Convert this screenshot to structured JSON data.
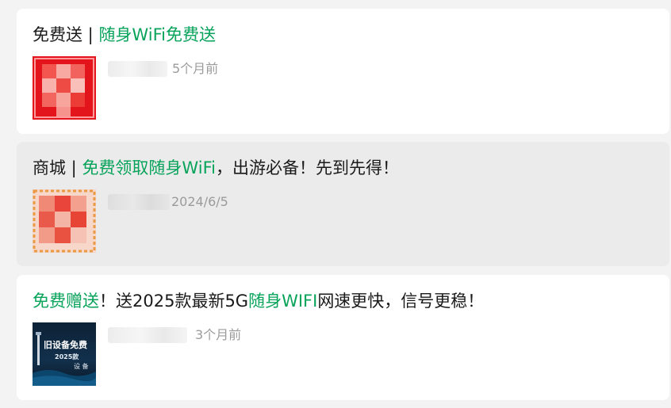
{
  "articles": [
    {
      "title_parts": [
        {
          "text": "免费送 | ",
          "highlight": false
        },
        {
          "text": "随身WiFi免费送",
          "highlight": true
        }
      ],
      "time": "5个月前",
      "thumbnail_icon": "red-logo-thumbnail-icon"
    },
    {
      "title_parts": [
        {
          "text": "商城 | ",
          "highlight": false
        },
        {
          "text": "免费领取随身WiFi",
          "highlight": true
        },
        {
          "text": "，出游必备！先到先得！",
          "highlight": false
        }
      ],
      "time": "2024/6/5",
      "thumbnail_icon": "promo-banner-thumbnail-icon"
    },
    {
      "title_parts": [
        {
          "text": "免费赠送",
          "highlight": true
        },
        {
          "text": "！送2025款最新5G",
          "highlight": false
        },
        {
          "text": "随身WIFI",
          "highlight": true
        },
        {
          "text": "网速更快，信号更稳！",
          "highlight": false
        }
      ],
      "time": "3个月前",
      "thumbnail_icon": "device-trade-in-thumbnail-icon",
      "thumbnail_lines": [
        "旧设备免费",
        "2025款",
        "设 备"
      ]
    }
  ],
  "colors": {
    "highlight": "#07a35a",
    "text": "#1a1a1a",
    "muted": "#9b9b9b",
    "card_hover": "#ebebeb",
    "card": "#ffffff",
    "page": "#f3f3f3"
  }
}
